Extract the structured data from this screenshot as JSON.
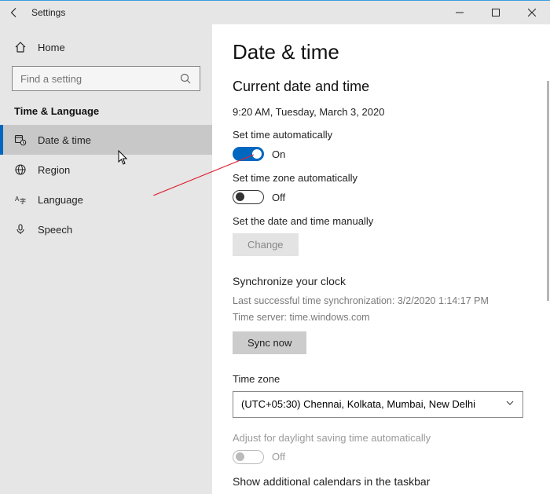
{
  "titlebar": {
    "title": "Settings"
  },
  "sidebar": {
    "home": "Home",
    "search_placeholder": "Find a setting",
    "section": "Time & Language",
    "items": [
      {
        "label": "Date & time"
      },
      {
        "label": "Region"
      },
      {
        "label": "Language"
      },
      {
        "label": "Speech"
      }
    ]
  },
  "main": {
    "title": "Date & time",
    "current_header": "Current date and time",
    "current_value": "9:20 AM, Tuesday, March 3, 2020",
    "set_time_auto_label": "Set time automatically",
    "set_time_auto_state": "On",
    "set_tz_auto_label": "Set time zone automatically",
    "set_tz_auto_state": "Off",
    "manual_label": "Set the date and time manually",
    "change_btn": "Change",
    "sync_header": "Synchronize your clock",
    "sync_line1": "Last successful time synchronization: 3/2/2020 1:14:17 PM",
    "sync_line2": "Time server: time.windows.com",
    "sync_btn": "Sync now",
    "tz_label": "Time zone",
    "tz_value": "(UTC+05:30) Chennai, Kolkata, Mumbai, New Delhi",
    "dst_label": "Adjust for daylight saving time automatically",
    "dst_state": "Off",
    "additional_header": "Show additional calendars in the taskbar"
  }
}
